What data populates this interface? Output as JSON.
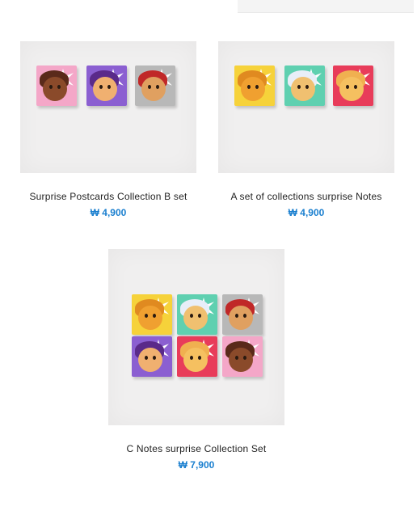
{
  "products": [
    {
      "name": "Surprise Postcards Collection B set",
      "price": "₩ 4,900",
      "cards": [
        {
          "bg": "#f4a7c8",
          "burst": "#ffffff",
          "face": "#8a4a2a",
          "hair": "#5a2a1a"
        },
        {
          "bg": "#8b5fd1",
          "burst": "#ffffff",
          "face": "#f0b070",
          "hair": "#5a2a8a"
        },
        {
          "bg": "#b8b8b8",
          "burst": "#ffffff",
          "face": "#e0a060",
          "hair": "#c02828"
        }
      ]
    },
    {
      "name": "A set of collections surprise Notes",
      "price": "₩ 4,900",
      "cards": [
        {
          "bg": "#f6d23a",
          "burst": "#ffffff",
          "face": "#f0a030",
          "hair": "#e08a20"
        },
        {
          "bg": "#5fd0b0",
          "burst": "#ffffff",
          "face": "#f0c070",
          "hair": "#e8eef8"
        },
        {
          "bg": "#e83c5a",
          "burst": "#ffffff",
          "face": "#f5c060",
          "hair": "#f0b050"
        }
      ]
    },
    {
      "name": "C Notes surprise Collection Set",
      "price": "₩ 7,900",
      "cards": [
        {
          "bg": "#f6d23a",
          "burst": "#ffffff",
          "face": "#f0a030",
          "hair": "#e08a20"
        },
        {
          "bg": "#5fd0b0",
          "burst": "#ffffff",
          "face": "#f0c070",
          "hair": "#e8eef8"
        },
        {
          "bg": "#b8b8b8",
          "burst": "#ffffff",
          "face": "#e0a060",
          "hair": "#c02828"
        },
        {
          "bg": "#8b5fd1",
          "burst": "#ffffff",
          "face": "#f0b070",
          "hair": "#5a2a8a"
        },
        {
          "bg": "#e83c5a",
          "burst": "#ffffff",
          "face": "#f5c060",
          "hair": "#f0b050"
        },
        {
          "bg": "#f4a7c8",
          "burst": "#ffffff",
          "face": "#8a4a2a",
          "hair": "#5a2a1a"
        }
      ]
    }
  ],
  "colors": {
    "price": "#1a7fcf",
    "text": "#222222"
  }
}
